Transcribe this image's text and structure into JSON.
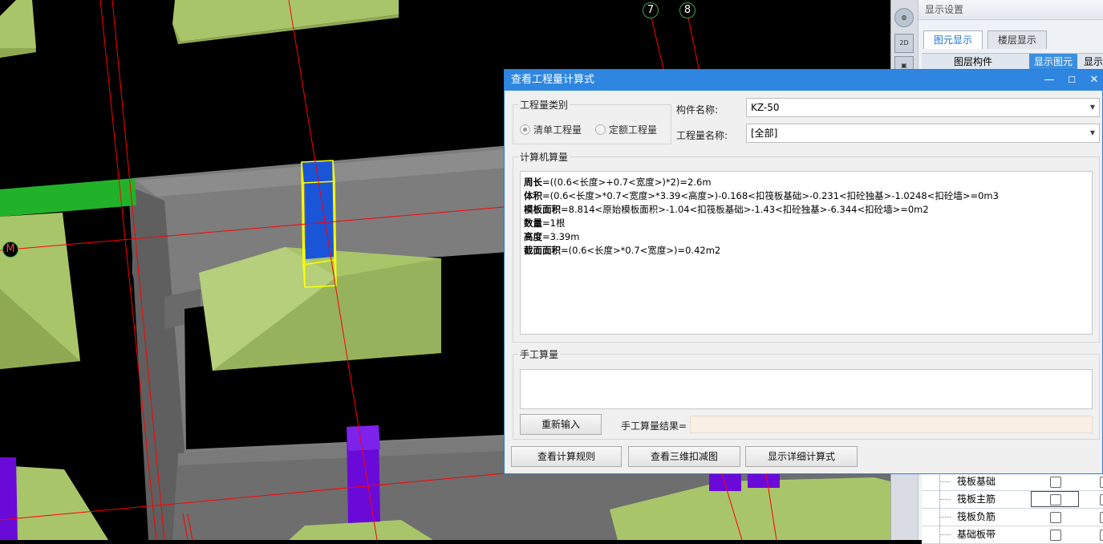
{
  "viewport": {
    "axis_labels": [
      "7",
      "8",
      "M"
    ]
  },
  "side_toolbar": {
    "btn_2d": "2D"
  },
  "display_panel": {
    "title": "显示设置",
    "tabs": [
      "图元显示",
      "楼层显示"
    ],
    "columns": [
      "图层构件",
      "显示图元",
      "显示"
    ],
    "rows": [
      {
        "label": "筏板基础"
      },
      {
        "label": "筏板主筋"
      },
      {
        "label": "筏板负筋"
      },
      {
        "label": "基础板带"
      }
    ]
  },
  "dialog": {
    "title": "查看工程量计算式",
    "window_buttons": [
      "—",
      "☐",
      "✕"
    ],
    "quantity_type": {
      "title": "工程量类别",
      "options": [
        "清单工程量",
        "定额工程量"
      ],
      "selected": "清单工程量"
    },
    "component_name_label": "构件名称:",
    "component_name_value": "KZ-50",
    "quantity_name_label": "工程量名称:",
    "quantity_name_value": "[全部]",
    "computer_calc": {
      "title": "计算机算量",
      "lines": [
        {
          "name": "周长",
          "expr": "=((0.6<长度>+0.7<宽度>)*2)=2.6m"
        },
        {
          "name": "体积",
          "expr": "=(0.6<长度>*0.7<宽度>*3.39<高度>)-0.168<扣筏板基础>-0.231<扣砼独基>-1.0248<扣砼墙>=0m3"
        },
        {
          "name": "模板面积",
          "expr": "=8.814<原始模板面积>-1.04<扣筏板基础>-1.43<扣砼独基>-6.344<扣砼墙>=0m2"
        },
        {
          "name": "数量",
          "expr": "=1根"
        },
        {
          "name": "高度",
          "expr": "=3.39m"
        },
        {
          "name": "截面面积",
          "expr": "=(0.6<长度>*0.7<宽度>)=0.42m2"
        }
      ]
    },
    "manual_calc": {
      "title": "手工算量",
      "reenter_button": "重新输入",
      "result_label": "手工算量结果=",
      "result_value": ""
    },
    "bottom_buttons": [
      "查看计算规则",
      "查看三维扣减图",
      "显示详细计算式"
    ]
  },
  "colors": {
    "title_bar": "#2f86e0",
    "column_blue": "#1a55d8",
    "column_purple": "#6a0ad8",
    "foundation_green": "#a9c56a",
    "wall_gray": "#7a7a7a",
    "beam_green": "#22b22a",
    "axis_red": "#ff0000",
    "highlight_yellow": "#ffff00"
  }
}
